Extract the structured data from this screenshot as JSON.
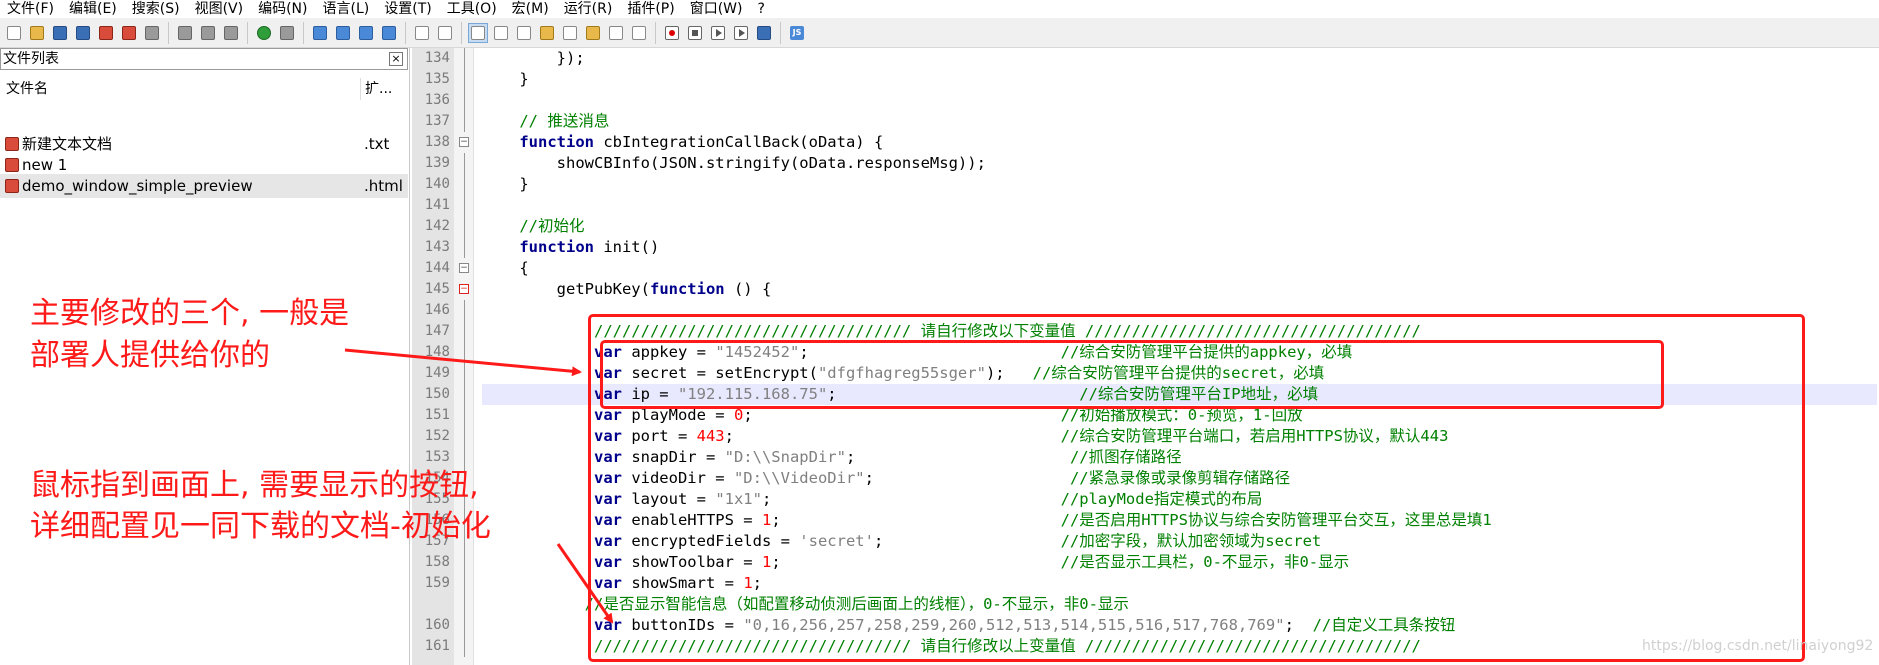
{
  "menu": [
    "文件(F)",
    "编辑(E)",
    "搜索(S)",
    "视图(V)",
    "编码(N)",
    "语言(L)",
    "设置(T)",
    "工具(O)",
    "宏(M)",
    "运行(R)",
    "插件(P)",
    "窗口(W)",
    "?"
  ],
  "toolbar": {
    "icons": [
      "new-file-icon",
      "open-file-icon",
      "save-icon",
      "save-all-icon",
      "close-icon",
      "close-all-icon",
      "print-icon",
      "cut-icon",
      "copy-icon",
      "paste-icon",
      "undo-icon",
      "redo-icon",
      "find-icon",
      "replace-icon",
      "zoom-in-icon",
      "zoom-out-icon",
      "sync-vertical-icon",
      "sync-horizontal-icon",
      "word-wrap-icon",
      "show-all-chars-icon",
      "indent-guide-icon",
      "user-lang-icon",
      "function-list-icon",
      "folder-workspace-icon",
      "doc-map-icon",
      "monitor-icon",
      "record-macro-icon",
      "stop-record-icon",
      "play-macro-icon",
      "run-macro-multiple-icon",
      "save-macro-icon",
      "jslint-icon"
    ],
    "active_index": 18
  },
  "file_panel": {
    "title": "文件列表",
    "close_glyph": "×",
    "col_name": "文件名",
    "col_ext": "扩...",
    "files": [
      {
        "name": "新建文本文档",
        "ext": ".txt"
      },
      {
        "name": "new 1",
        "ext": ""
      },
      {
        "name": "demo_window_simple_preview",
        "ext": ".html"
      }
    ],
    "selected_index": 2
  },
  "editor": {
    "current_line": "150",
    "lines": [
      {
        "num": "134",
        "fold": "line",
        "html": "        });"
      },
      {
        "num": "135",
        "fold": "line",
        "html": "    }"
      },
      {
        "num": "136",
        "fold": "line",
        "html": ""
      },
      {
        "num": "137",
        "fold": "line",
        "html": "    <span class=\"cmt\">// 推送消息</span>"
      },
      {
        "num": "138",
        "fold": "box",
        "html": "    <span class=\"kw\">function</span> cbIntegrationCallBack(oData) {"
      },
      {
        "num": "139",
        "fold": "line",
        "html": "        showCBInfo(JSON.stringify(oData.responseMsg));"
      },
      {
        "num": "140",
        "fold": "end",
        "html": "    }"
      },
      {
        "num": "141",
        "fold": "line",
        "html": ""
      },
      {
        "num": "142",
        "fold": "line",
        "html": "    <span class=\"cmt\">//初始化</span>"
      },
      {
        "num": "143",
        "fold": "line",
        "html": "    <span class=\"kw\">function</span> init()"
      },
      {
        "num": "144",
        "fold": "box",
        "html": "    {"
      },
      {
        "num": "145",
        "fold": "boxred",
        "html": "        getPubKey(<span class=\"kw\">function</span> () {"
      },
      {
        "num": "146",
        "fold": "line",
        "html": ""
      },
      {
        "num": "147",
        "fold": "line",
        "html": "            <span class=\"cmt\">////////////////////////////////// 请自行修改以下变量值 ////////////////////////////////////</span>"
      },
      {
        "num": "148",
        "fold": "line",
        "html": "            <span class=\"kw\">var</span> appkey = <span class=\"str\">\"1452452\"</span>;                           <span class=\"cmt\">//综合安防管理平台提供的appkey，必填</span>"
      },
      {
        "num": "149",
        "fold": "line",
        "html": "            <span class=\"kw\">var</span> secret = setEncrypt(<span class=\"str\">\"dfgfhagreg55sger\"</span>);   <span class=\"cmt\">//综合安防管理平台提供的secret，必填</span>"
      },
      {
        "num": "150",
        "fold": "line",
        "html": "            <span class=\"kw\">var</span> ip = <span class=\"str\">\"192.115.168.75\"</span>;                          <span class=\"cmt\">//综合安防管理平台IP地址，必填</span>"
      },
      {
        "num": "151",
        "fold": "line",
        "html": "            <span class=\"kw\">var</span> playMode = <span class=\"num\">0</span>;                                 <span class=\"cmt\">//初始播放模式：0-预览，1-回放</span>"
      },
      {
        "num": "152",
        "fold": "line",
        "html": "            <span class=\"kw\">var</span> port = <span class=\"num\">443</span>;                                   <span class=\"cmt\">//综合安防管理平台端口，若启用HTTPS协议，默认443</span>"
      },
      {
        "num": "153",
        "fold": "line",
        "html": "            <span class=\"kw\">var</span> snapDir = <span class=\"str\">\"D:\\\\SnapDir\"</span>;                       <span class=\"cmt\">//抓图存储路径</span>"
      },
      {
        "num": "154",
        "fold": "line",
        "html": "            <span class=\"kw\">var</span> videoDir = <span class=\"str\">\"D:\\\\VideoDir\"</span>;                     <span class=\"cmt\">//紧急录像或录像剪辑存储路径</span>"
      },
      {
        "num": "155",
        "fold": "line",
        "html": "            <span class=\"kw\">var</span> layout = <span class=\"str\">\"1x1\"</span>;                               <span class=\"cmt\">//playMode指定模式的布局</span>"
      },
      {
        "num": "156",
        "fold": "line",
        "html": "            <span class=\"kw\">var</span> enableHTTPS = <span class=\"num\">1</span>;                              <span class=\"cmt\">//是否启用HTTPS协议与综合安防管理平台交互，这里总是填1</span>"
      },
      {
        "num": "157",
        "fold": "line",
        "html": "            <span class=\"kw\">var</span> encryptedFields = <span class=\"str\">'secret'</span>;                   <span class=\"cmt\">//加密字段，默认加密领域为secret</span>"
      },
      {
        "num": "158",
        "fold": "line",
        "html": "            <span class=\"kw\">var</span> showToolbar = <span class=\"num\">1</span>;                              <span class=\"cmt\">//是否显示工具栏，0-不显示，非0-显示</span>"
      },
      {
        "num": "159",
        "fold": "line",
        "html": "            <span class=\"kw\">var</span> showSmart = <span class=\"num\">1</span>;"
      },
      {
        "num": "",
        "fold": "line",
        "html": "           <span class=\"cmt\">//是否显示智能信息（如配置移动侦测后画面上的线框），0-不显示，非0-显示</span>"
      },
      {
        "num": "160",
        "fold": "line",
        "html": "            <span class=\"kw\">var</span> buttonIDs = <span class=\"str\">\"0,16,256,257,258,259,260,512,513,514,515,516,517,768,769\"</span>;  <span class=\"cmt\">//自定义工具条按钮</span>"
      },
      {
        "num": "161",
        "fold": "line",
        "html": "            <span class=\"cmt\">////////////////////////////////// 请自行修改以上变量值 ////////////////////////////////////</span>"
      }
    ]
  },
  "annotations": {
    "text1_line1": "主要修改的三个, 一般是",
    "text1_line2": "部署人提供给你的",
    "text2_line1": "鼠标指到画面上, 需要显示的按钮,",
    "text2_line2": "详细配置见一同下载的文档-初始化",
    "color": "#ff1a1a"
  },
  "watermark": "https://blog.csdn.net/linaiyong92"
}
